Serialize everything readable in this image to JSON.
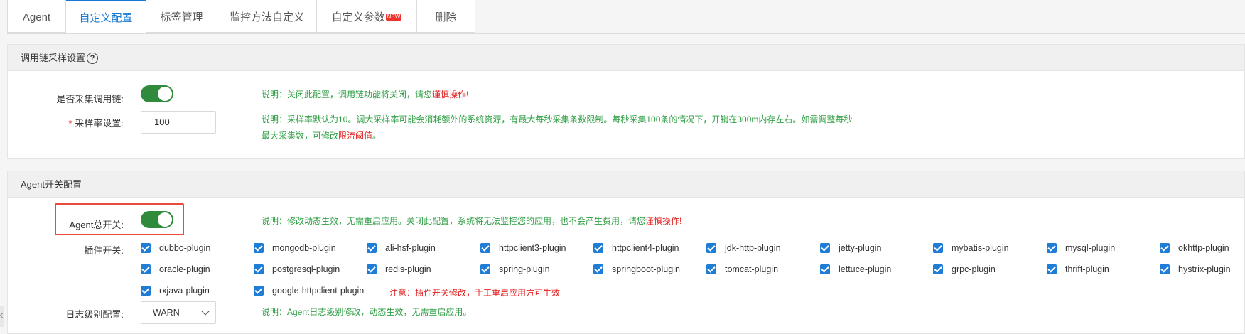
{
  "tabs": [
    {
      "label": "Agent",
      "active": false
    },
    {
      "label": "自定义配置",
      "active": true
    },
    {
      "label": "标签管理",
      "active": false
    },
    {
      "label": "监控方法自定义",
      "active": false
    },
    {
      "label": "自定义参数",
      "active": false,
      "badge": "NEW"
    },
    {
      "label": "删除",
      "active": false
    }
  ],
  "trace": {
    "title": "调用链采样设置",
    "help": "?",
    "collect_label": "是否采集调用链:",
    "collect_enabled": true,
    "collect_note_prefix": "说明：关闭此配置，调用链功能将关闭，请您",
    "collect_note_warn": "谨慎操作!",
    "rate_required": "*",
    "rate_label": "采样率设置:",
    "rate_value": "100",
    "rate_note_line1": "说明：采样率默认为10。调大采样率可能会消耗额外的系统资源，有最大每秒采集条数限制。每秒采集100条的情况下，开销在300m内存左右。如需调整每秒",
    "rate_note_line2_prefix": "最大采集数，可修改",
    "rate_note_line2_warn": "限流阈值",
    "rate_note_line2_suffix": "。"
  },
  "agent": {
    "title": "Agent开关配置",
    "master_label": "Agent总开关:",
    "master_enabled": true,
    "master_note_prefix": "说明：修改动态生效，无需重启应用。关闭此配置，系统将无法监控您的应用，也不会产生费用，请您",
    "master_note_warn": "谨慎操作!",
    "plugins_label": "插件开关:",
    "plugins_row1": [
      "dubbo-plugin",
      "mongodb-plugin",
      "ali-hsf-plugin",
      "httpclient3-plugin",
      "httpclient4-plugin",
      "jdk-http-plugin",
      "jetty-plugin",
      "mybatis-plugin",
      "mysql-plugin",
      "okhttp-plugin"
    ],
    "plugins_row2": [
      "oracle-plugin",
      "postgresql-plugin",
      "redis-plugin",
      "spring-plugin",
      "springboot-plugin",
      "tomcat-plugin",
      "lettuce-plugin",
      "grpc-plugin",
      "thrift-plugin",
      "hystrix-plugin"
    ],
    "plugins_row3": [
      "rxjava-plugin",
      "google-httpclient-plugin"
    ],
    "plugin_note": "注意：插件开关修改，手工重启应用方可生效",
    "log_label": "日志级别配置:",
    "log_value": "WARN",
    "log_note": "说明：Agent日志级别修改，动态生效，无需重启应用。"
  },
  "colors": {
    "accent": "#1677d4",
    "toggle_on": "#2f8a3b",
    "note": "#2f9e44",
    "warn": "#e02020",
    "highlight": "#e84a3c"
  }
}
